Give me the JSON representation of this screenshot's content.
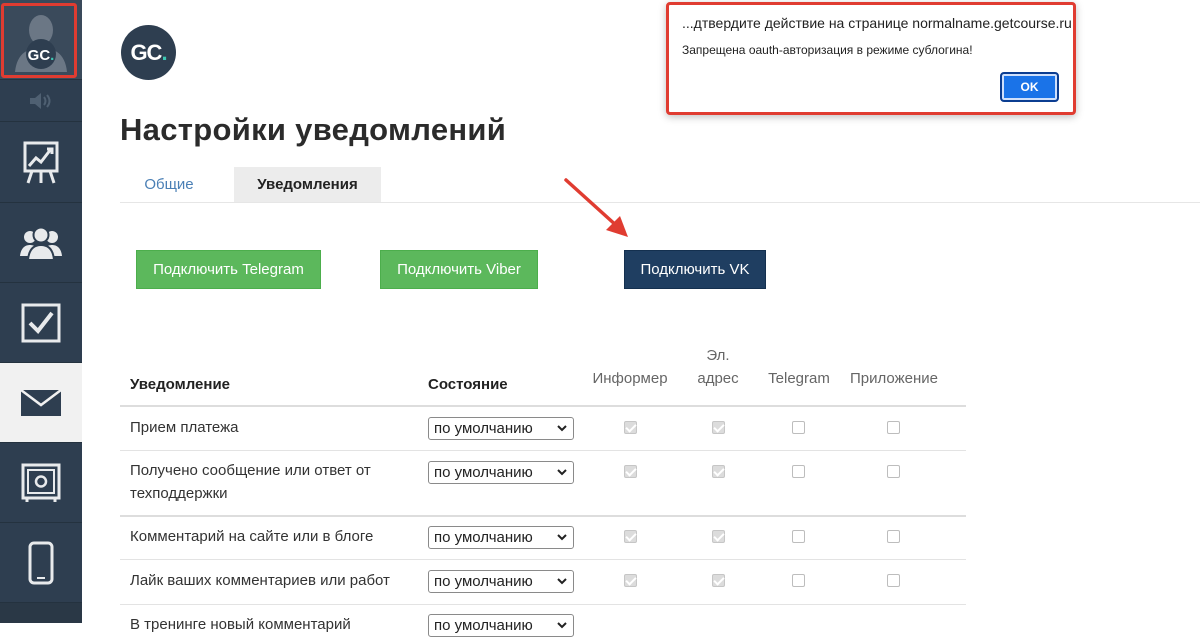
{
  "sidebar": {
    "items": [
      {
        "icon": "avatar-icon",
        "logo_text": "GC."
      },
      {
        "icon": "speaker-icon"
      },
      {
        "icon": "chart-icon"
      },
      {
        "icon": "users-icon"
      },
      {
        "icon": "checkbox-icon"
      },
      {
        "icon": "mail-icon"
      },
      {
        "icon": "safe-icon"
      },
      {
        "icon": "mobile-icon"
      }
    ],
    "highlight_color": "#e03c31"
  },
  "logo": {
    "text": "GC",
    "dot": "."
  },
  "page_title": "Настройки уведомлений",
  "tabs": [
    {
      "label": "Общие"
    },
    {
      "label": "Уведомления"
    }
  ],
  "buttons": {
    "telegram": "Подключить Telegram",
    "viber": "Подключить Viber",
    "vk": "Подключить VK"
  },
  "colors": {
    "green": "#5cb85c",
    "navy": "#1f3e61",
    "accent": "#e03c31"
  },
  "table": {
    "headers": {
      "notification": "Уведомление",
      "state": "Состояние",
      "informer": "Информер",
      "email_1": "Эл.",
      "email_2": "адрес",
      "telegram": "Telegram",
      "app": "Приложение"
    },
    "rows": [
      {
        "name": "Прием платежа",
        "state": "по умолчанию",
        "informer": true,
        "email": true,
        "telegram": false,
        "app": false
      },
      {
        "name": "Получено сообщение или ответ от техподдержки",
        "state": "по умолчанию",
        "informer": true,
        "email": true,
        "telegram": false,
        "app": false
      },
      {
        "name": "Комментарий на сайте или в блоге",
        "state": "по умолчанию",
        "informer": true,
        "email": true,
        "telegram": false,
        "app": false
      },
      {
        "name": "Лайк ваших комментариев или работ",
        "state": "по умолчанию",
        "informer": true,
        "email": true,
        "telegram": false,
        "app": false
      },
      {
        "name": "В тренинге новый комментарий",
        "state": "по умолчанию",
        "informer": true,
        "email": true,
        "telegram": false,
        "app": false
      }
    ]
  },
  "dialog": {
    "title": "...дтвердите действие на странице normalname.getcourse.ru",
    "message": "Запрещена oauth-авторизация в режиме сублогина!",
    "ok_label": "OK"
  }
}
